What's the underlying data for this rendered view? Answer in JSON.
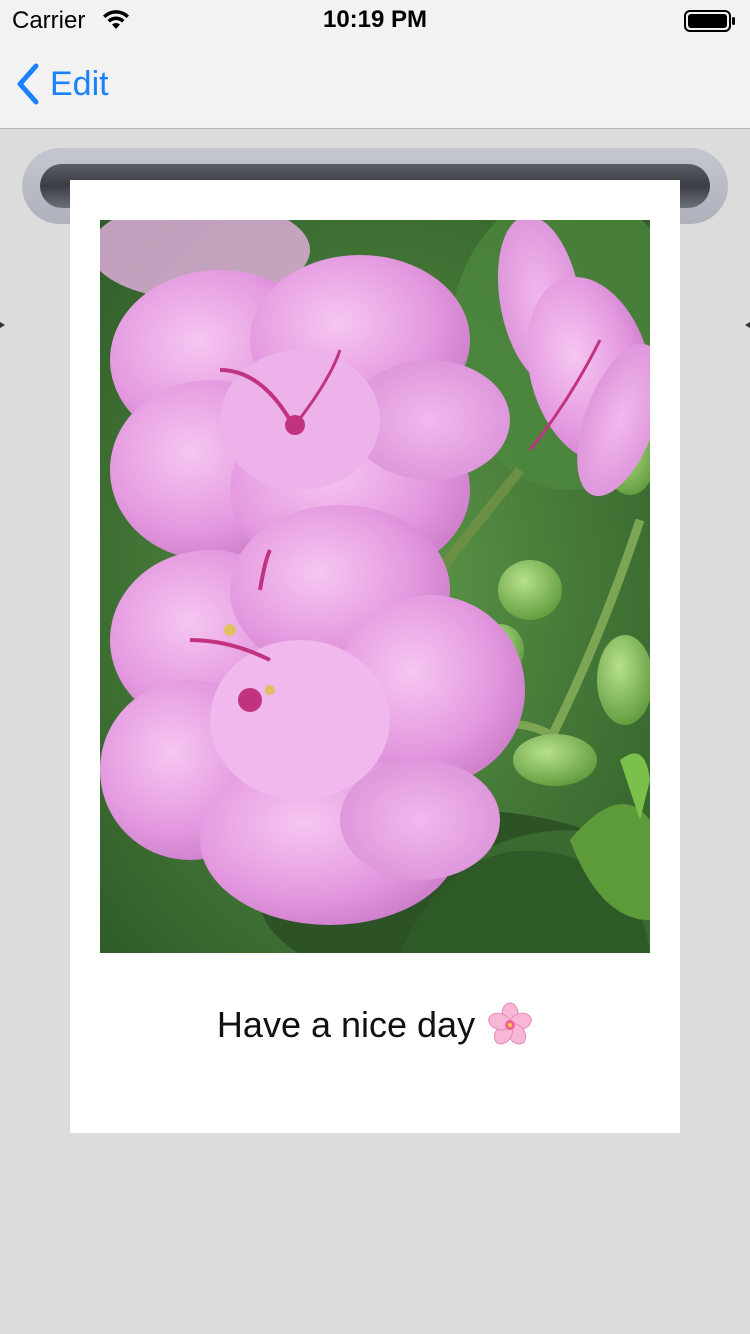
{
  "status_bar": {
    "carrier": "Carrier",
    "time": "10:19 PM",
    "icons": [
      "wifi-icon",
      "battery-icon"
    ]
  },
  "nav": {
    "back_label": "Edit",
    "back_icon": "chevron-left-icon",
    "accent_color": "#1a82fb"
  },
  "card": {
    "photo_subject": "flower-photo",
    "caption": "Have a nice day",
    "caption_icon": "cherry-blossom-icon"
  }
}
